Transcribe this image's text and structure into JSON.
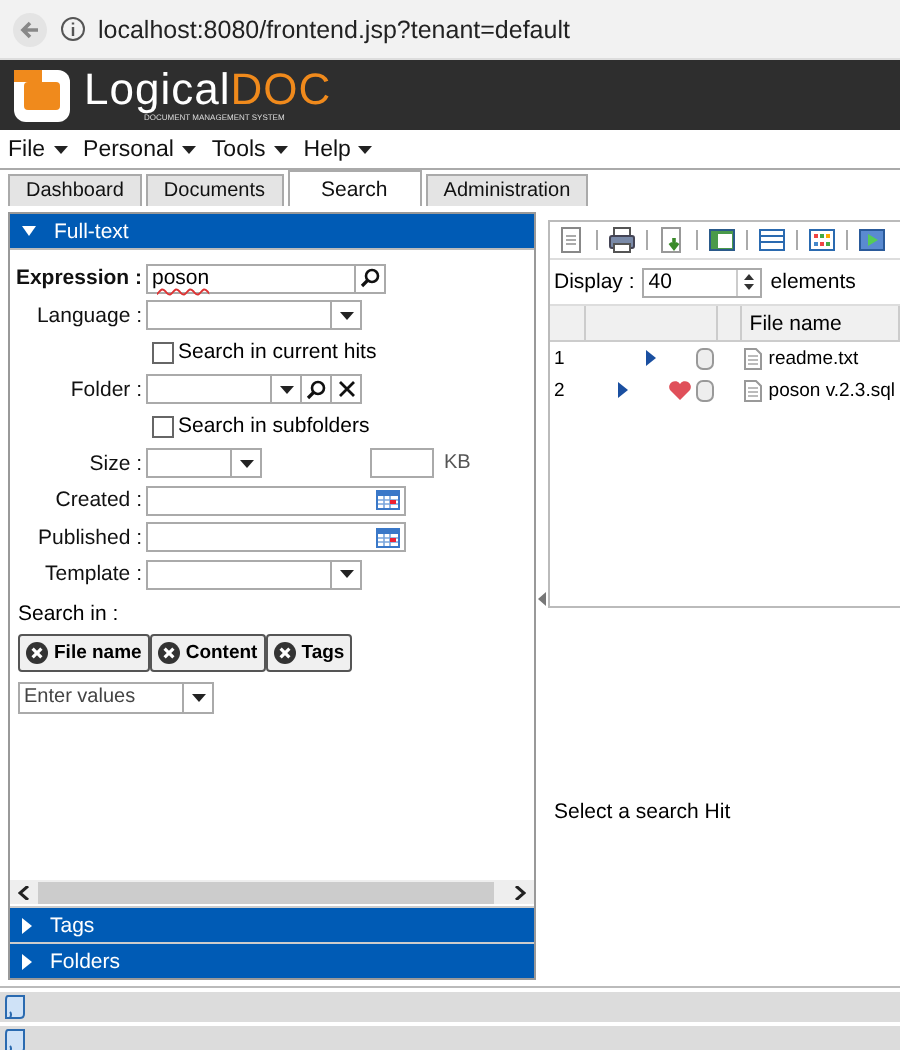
{
  "browser": {
    "url": "localhost:8080/frontend.jsp?tenant=default"
  },
  "logo": {
    "name": "Logical",
    "highlight": "DOC",
    "tagline": "DOCUMENT MANAGEMENT SYSTEM"
  },
  "menu": [
    "File",
    "Personal",
    "Tools",
    "Help"
  ],
  "tabs": [
    {
      "label": "Dashboard",
      "selected": false
    },
    {
      "label": "Documents",
      "selected": false
    },
    {
      "label": "Search",
      "selected": true
    },
    {
      "label": "Administration",
      "selected": false
    }
  ],
  "search_panel": {
    "title": "Full-text",
    "expanded": true,
    "fields": [
      {
        "kind": "search",
        "label": "Expression :",
        "value": "poson"
      },
      {
        "kind": "select",
        "label": "Language :"
      },
      {
        "kind": "checkbox",
        "label": "Search in current hits",
        "checked": false
      },
      {
        "kind": "folder",
        "label": "Folder :"
      },
      {
        "kind": "checkbox",
        "label": "Search in subfolders",
        "checked": false
      },
      {
        "kind": "size",
        "label": "Size :",
        "unit": "KB"
      },
      {
        "kind": "date",
        "label": "Created :"
      },
      {
        "kind": "date",
        "label": "Published :"
      },
      {
        "kind": "select",
        "label": "Template :"
      }
    ],
    "search_in": {
      "label": "Search in :",
      "chips": [
        "File name",
        "Content",
        "Tags"
      ],
      "placeholder": "Enter values"
    }
  },
  "collapsed_sections": [
    {
      "title": "Tags",
      "expanded": false
    },
    {
      "title": "Folders",
      "expanded": false
    }
  ],
  "results": {
    "display_label": "Display :",
    "display_value": "40",
    "display_unit": "elements",
    "columns": [
      "File name"
    ],
    "rows": [
      {
        "number": "1",
        "name": "readme.txt",
        "bookmarked": false
      },
      {
        "number": "2",
        "name": "poson v.2.3.sql",
        "bookmarked": true
      }
    ]
  },
  "preview": {
    "message": "Select a search Hit"
  }
}
